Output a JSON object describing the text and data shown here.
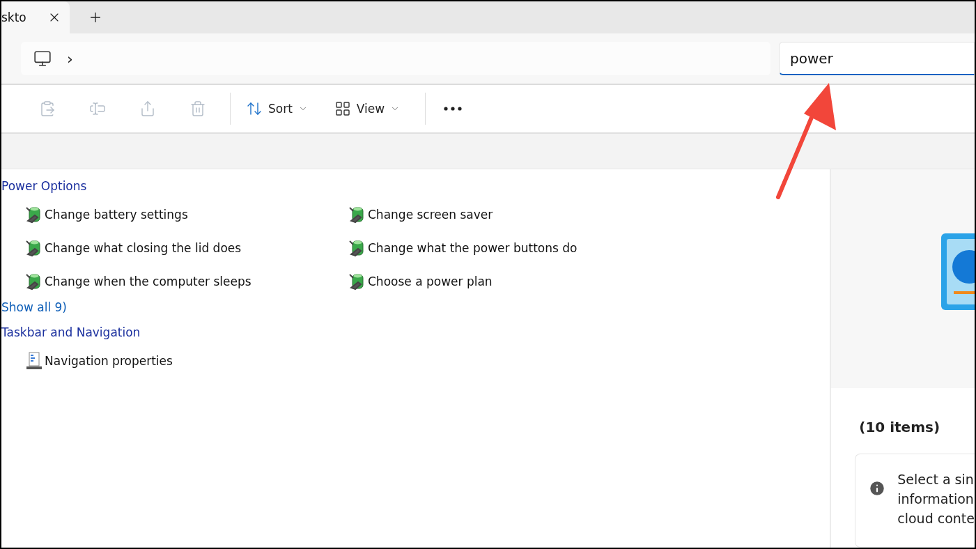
{
  "tab": {
    "title": "skto"
  },
  "address": {
    "separator": "›"
  },
  "search": {
    "value": "power"
  },
  "toolbar": {
    "actions": [
      {
        "kind": "paste",
        "disabled": true
      },
      {
        "kind": "rename",
        "disabled": true
      },
      {
        "kind": "share",
        "disabled": true
      },
      {
        "kind": "delete",
        "disabled": true
      }
    ],
    "menus": [
      {
        "kind": "sort",
        "label": "Sort"
      },
      {
        "kind": "view",
        "label": "View"
      }
    ]
  },
  "results": [
    {
      "title": "Power Options",
      "items": [
        {
          "label": "Change battery settings"
        },
        {
          "label": "Change screen saver"
        },
        {
          "label": "Change what closing the lid does"
        },
        {
          "label": "Change what the power buttons do"
        },
        {
          "label": "Change when the computer sleeps"
        },
        {
          "label": "Choose a power plan"
        }
      ],
      "more": "Show all 9)"
    },
    {
      "title": "Taskbar and Navigation",
      "items": [
        {
          "label": "Navigation properties"
        }
      ]
    }
  ],
  "details": {
    "count": "(10 items)",
    "info_lines": [
      "Select a sin",
      "information",
      "cloud conte"
    ]
  }
}
